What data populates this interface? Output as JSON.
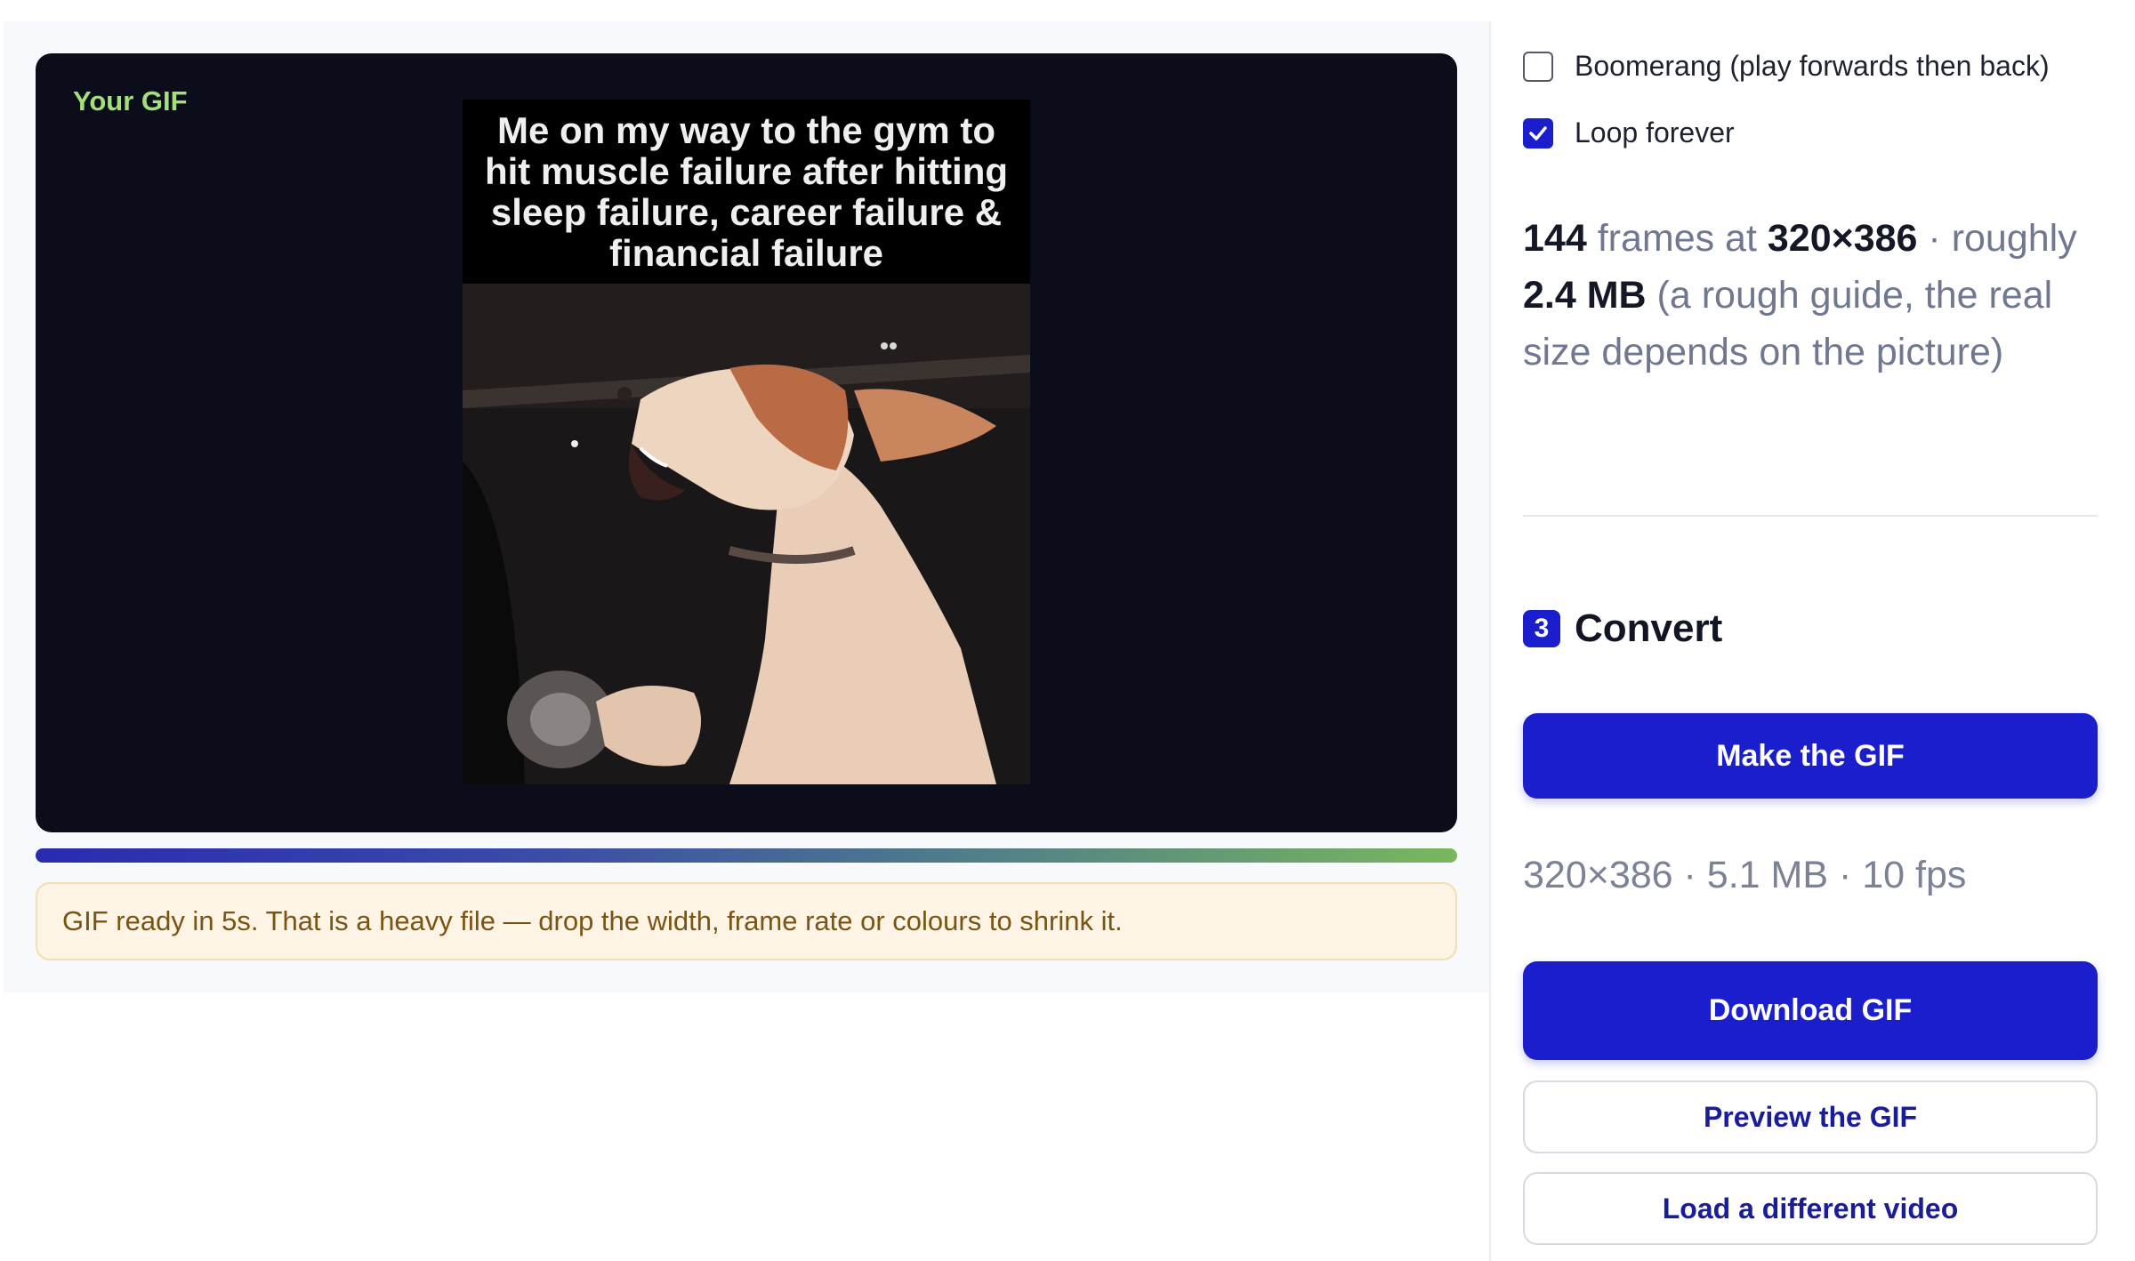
{
  "preview": {
    "label": "Your GIF",
    "caption": "Me on my way to the gym to hit muscle failure after hitting sleep failure, career failure & financial failure"
  },
  "progress": {
    "fraction": 1.0
  },
  "notice": {
    "text": "GIF ready in 5s. That is a heavy file — drop the width, frame rate or colours to shrink it."
  },
  "options": {
    "boomerang": {
      "label": "Boomerang (play forwards then back)",
      "checked": false
    },
    "loop": {
      "label": "Loop forever",
      "checked": true
    }
  },
  "stats": {
    "frames": "144",
    "frames_suffix": " frames at ",
    "dimensions": "320×386",
    "dot_roughly": " · roughly ",
    "size": "2.4 MB",
    "note": " (a rough guide, the real size depends on the picture)"
  },
  "convert": {
    "step_number": "3",
    "title": "Convert",
    "make_label": "Make the GIF",
    "result": "320×386 · 5.1 MB · 10 fps",
    "download_label": "Download GIF",
    "preview_label": "Preview the GIF",
    "load_label": "Load a different video"
  },
  "colors": {
    "accent": "#1b1ecc",
    "notice_bg": "#fdf4e6",
    "notice_text": "#7a5412",
    "label_green": "#a3e07a"
  }
}
